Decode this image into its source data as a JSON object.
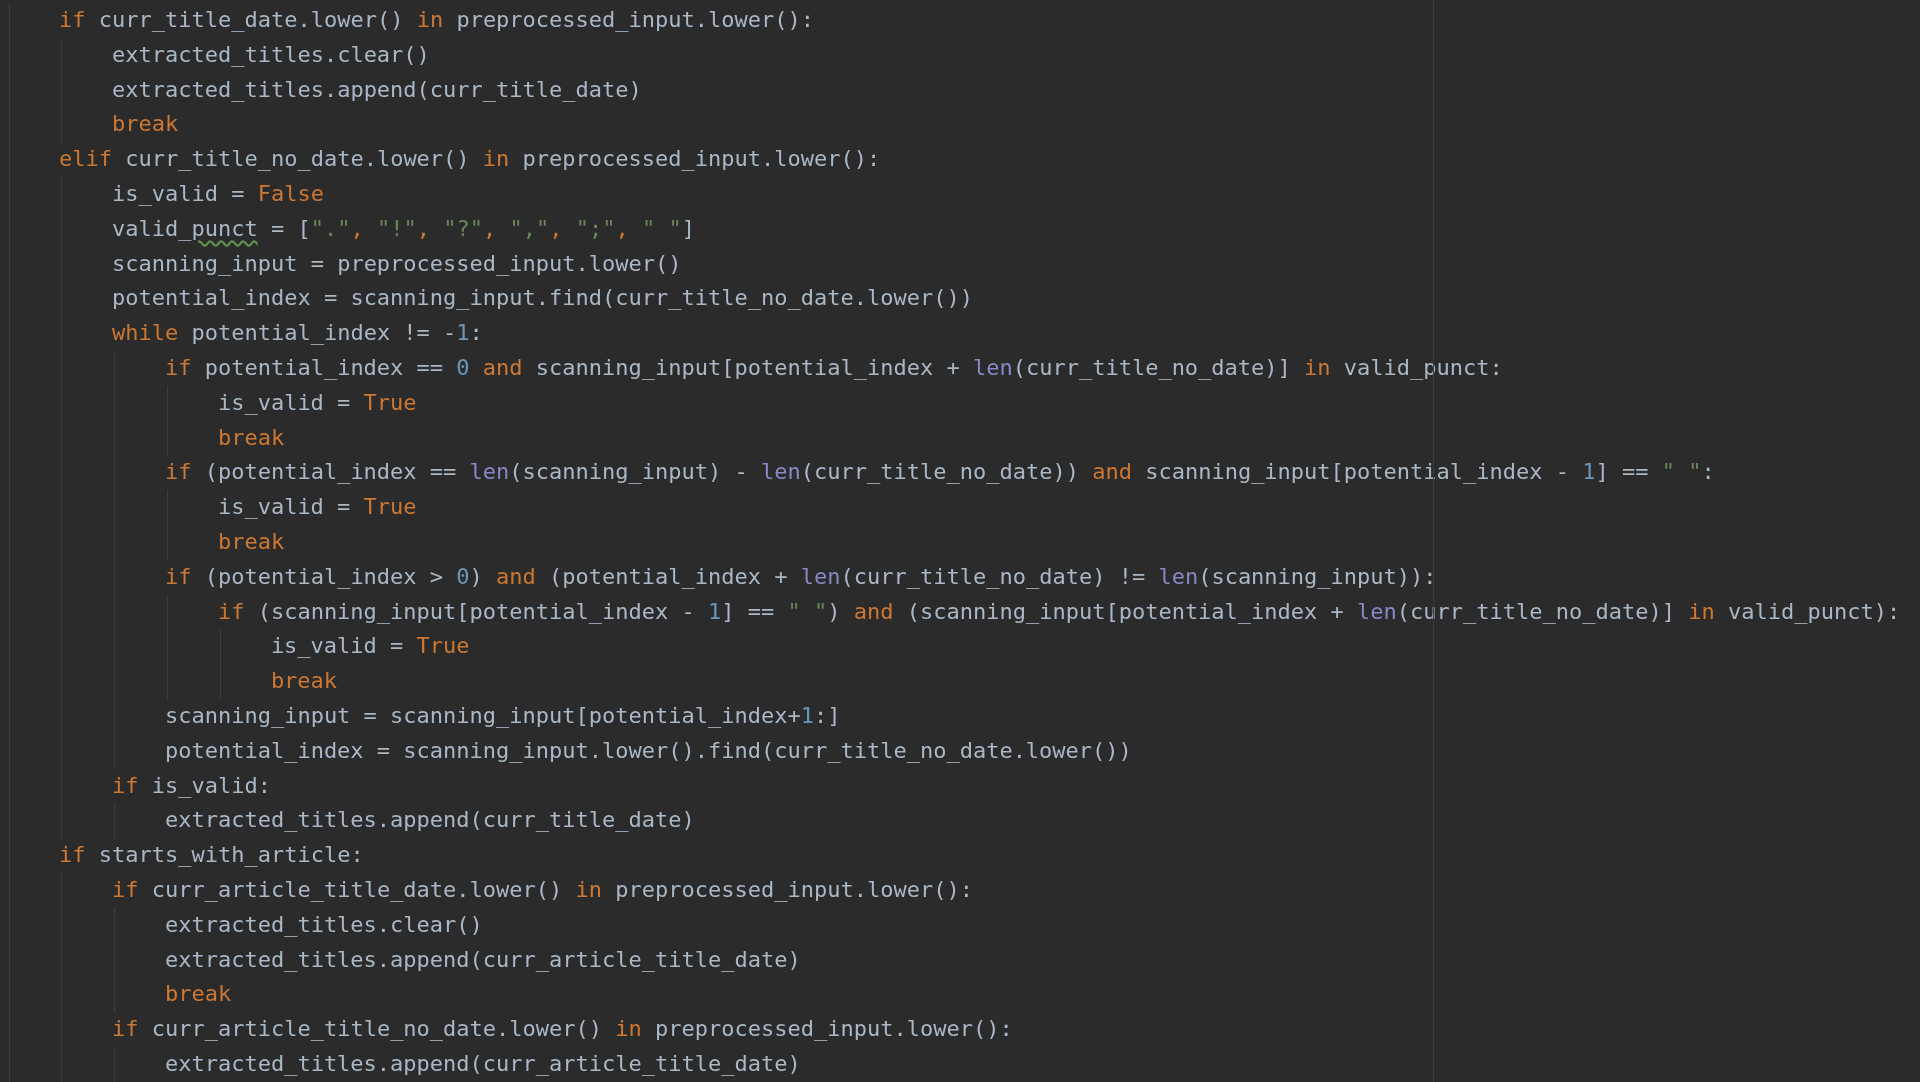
{
  "editor": {
    "lines": [
      {
        "tokens": [
          {
            "text": "if",
            "kind": "keyword"
          },
          {
            "text": " curr_title_date.lower() ",
            "kind": "plain"
          },
          {
            "text": "in",
            "kind": "keyword"
          },
          {
            "text": " preprocessed_input.lower():",
            "kind": "plain"
          }
        ],
        "children": [
          {
            "tokens": [
              {
                "text": "extracted_titles.clear()",
                "kind": "plain"
              }
            ]
          },
          {
            "tokens": [
              {
                "text": "extracted_titles.append(curr_title_date)",
                "kind": "plain"
              }
            ]
          },
          {
            "tokens": [
              {
                "text": "break",
                "kind": "keyword"
              }
            ]
          }
        ]
      },
      {
        "tokens": [
          {
            "text": "elif",
            "kind": "keyword"
          },
          {
            "text": " curr_title_no_date.lower() ",
            "kind": "plain"
          },
          {
            "text": "in",
            "kind": "keyword"
          },
          {
            "text": " preprocessed_input.lower():",
            "kind": "plain"
          }
        ],
        "children": [
          {
            "tokens": [
              {
                "text": "is_valid = ",
                "kind": "plain"
              },
              {
                "text": "False",
                "kind": "keyword"
              }
            ]
          },
          {
            "tokens": [
              {
                "text": "valid_",
                "kind": "plain"
              },
              {
                "text": "punct",
                "kind": "typo"
              },
              {
                "text": " = [",
                "kind": "plain"
              },
              {
                "text": "\".\"",
                "kind": "string"
              },
              {
                "text": ", ",
                "kind": "comma"
              },
              {
                "text": "\"!\"",
                "kind": "string"
              },
              {
                "text": ", ",
                "kind": "comma"
              },
              {
                "text": "\"?\"",
                "kind": "string"
              },
              {
                "text": ", ",
                "kind": "comma"
              },
              {
                "text": "\",\"",
                "kind": "string"
              },
              {
                "text": ", ",
                "kind": "comma"
              },
              {
                "text": "\";\"",
                "kind": "string"
              },
              {
                "text": ", ",
                "kind": "comma"
              },
              {
                "text": "\" \"",
                "kind": "string"
              },
              {
                "text": "]",
                "kind": "plain"
              }
            ]
          },
          {
            "tokens": [
              {
                "text": "scanning_input = preprocessed_input.lower()",
                "kind": "plain"
              }
            ]
          },
          {
            "tokens": [
              {
                "text": "potential_index = scanning_input.find(curr_title_no_date.lower())",
                "kind": "plain"
              }
            ]
          },
          {
            "tokens": [
              {
                "text": "while",
                "kind": "keyword"
              },
              {
                "text": " potential_index != -",
                "kind": "plain"
              },
              {
                "text": "1",
                "kind": "number"
              },
              {
                "text": ":",
                "kind": "plain"
              }
            ],
            "children": [
              {
                "tokens": [
                  {
                    "text": "if",
                    "kind": "keyword"
                  },
                  {
                    "text": " potential_index == ",
                    "kind": "plain"
                  },
                  {
                    "text": "0 ",
                    "kind": "number"
                  },
                  {
                    "text": "and",
                    "kind": "keyword"
                  },
                  {
                    "text": " scanning_input[potential_index + ",
                    "kind": "plain"
                  },
                  {
                    "text": "len",
                    "kind": "builtin"
                  },
                  {
                    "text": "(curr_title_no_date)] ",
                    "kind": "plain"
                  },
                  {
                    "text": "in",
                    "kind": "keyword"
                  },
                  {
                    "text": " valid_punct:",
                    "kind": "plain"
                  }
                ],
                "children": [
                  {
                    "tokens": [
                      {
                        "text": "is_valid = ",
                        "kind": "plain"
                      },
                      {
                        "text": "True",
                        "kind": "keyword"
                      }
                    ]
                  },
                  {
                    "tokens": [
                      {
                        "text": "break",
                        "kind": "keyword"
                      }
                    ]
                  }
                ]
              },
              {
                "tokens": [
                  {
                    "text": "if",
                    "kind": "keyword"
                  },
                  {
                    "text": " (potential_index == ",
                    "kind": "plain"
                  },
                  {
                    "text": "len",
                    "kind": "builtin"
                  },
                  {
                    "text": "(scanning_input) - ",
                    "kind": "plain"
                  },
                  {
                    "text": "len",
                    "kind": "builtin"
                  },
                  {
                    "text": "(curr_title_no_date)) ",
                    "kind": "plain"
                  },
                  {
                    "text": "and",
                    "kind": "keyword"
                  },
                  {
                    "text": " scanning_input[potential_index - ",
                    "kind": "plain"
                  },
                  {
                    "text": "1",
                    "kind": "number"
                  },
                  {
                    "text": "] == ",
                    "kind": "plain"
                  },
                  {
                    "text": "\" \"",
                    "kind": "string"
                  },
                  {
                    "text": ":",
                    "kind": "plain"
                  }
                ],
                "children": [
                  {
                    "tokens": [
                      {
                        "text": "is_valid = ",
                        "kind": "plain"
                      },
                      {
                        "text": "True",
                        "kind": "keyword"
                      }
                    ]
                  },
                  {
                    "tokens": [
                      {
                        "text": "break",
                        "kind": "keyword"
                      }
                    ]
                  }
                ]
              },
              {
                "tokens": [
                  {
                    "text": "if",
                    "kind": "keyword"
                  },
                  {
                    "text": " (potential_index > ",
                    "kind": "plain"
                  },
                  {
                    "text": "0",
                    "kind": "number"
                  },
                  {
                    "text": ") ",
                    "kind": "plain"
                  },
                  {
                    "text": "and",
                    "kind": "keyword"
                  },
                  {
                    "text": " (potential_index + ",
                    "kind": "plain"
                  },
                  {
                    "text": "len",
                    "kind": "builtin"
                  },
                  {
                    "text": "(curr_title_no_date) != ",
                    "kind": "plain"
                  },
                  {
                    "text": "len",
                    "kind": "builtin"
                  },
                  {
                    "text": "(scanning_input)):",
                    "kind": "plain"
                  }
                ],
                "children": [
                  {
                    "tokens": [
                      {
                        "text": "if",
                        "kind": "keyword"
                      },
                      {
                        "text": " (scanning_input[potential_index - ",
                        "kind": "plain"
                      },
                      {
                        "text": "1",
                        "kind": "number"
                      },
                      {
                        "text": "] == ",
                        "kind": "plain"
                      },
                      {
                        "text": "\" \"",
                        "kind": "string"
                      },
                      {
                        "text": ") ",
                        "kind": "plain"
                      },
                      {
                        "text": "and",
                        "kind": "keyword"
                      },
                      {
                        "text": " (scanning_input[potential_index + ",
                        "kind": "plain"
                      },
                      {
                        "text": "len",
                        "kind": "builtin"
                      },
                      {
                        "text": "(curr_title_no_date)] ",
                        "kind": "plain"
                      },
                      {
                        "text": "in",
                        "kind": "keyword"
                      },
                      {
                        "text": " valid_punct):",
                        "kind": "plain"
                      }
                    ],
                    "children": [
                      {
                        "tokens": [
                          {
                            "text": "is_valid = ",
                            "kind": "plain"
                          },
                          {
                            "text": "True",
                            "kind": "keyword"
                          }
                        ]
                      },
                      {
                        "tokens": [
                          {
                            "text": "break",
                            "kind": "keyword"
                          }
                        ]
                      }
                    ]
                  }
                ]
              },
              {
                "tokens": [
                  {
                    "text": "scanning_input = scanning_input[potential_index+",
                    "kind": "plain"
                  },
                  {
                    "text": "1",
                    "kind": "number"
                  },
                  {
                    "text": ":]",
                    "kind": "plain"
                  }
                ]
              },
              {
                "tokens": [
                  {
                    "text": "potential_index = scanning_input.lower().find(curr_title_no_date.lower())",
                    "kind": "plain"
                  }
                ]
              }
            ]
          },
          {
            "tokens": [
              {
                "text": "if",
                "kind": "keyword"
              },
              {
                "text": " is_valid:",
                "kind": "plain"
              }
            ],
            "children": [
              {
                "tokens": [
                  {
                    "text": "extracted_titles.append(curr_title_date)",
                    "kind": "plain"
                  }
                ]
              }
            ]
          }
        ]
      },
      {
        "tokens": [
          {
            "text": "if",
            "kind": "keyword"
          },
          {
            "text": " starts_with_article:",
            "kind": "plain"
          }
        ],
        "children": [
          {
            "tokens": [
              {
                "text": "if",
                "kind": "keyword"
              },
              {
                "text": " curr_article_title_date.lower() ",
                "kind": "plain"
              },
              {
                "text": "in",
                "kind": "keyword"
              },
              {
                "text": " preprocessed_input.lower():",
                "kind": "plain"
              }
            ],
            "children": [
              {
                "tokens": [
                  {
                    "text": "extracted_titles.clear()",
                    "kind": "plain"
                  }
                ]
              },
              {
                "tokens": [
                  {
                    "text": "extracted_titles.append(curr_article_title_date)",
                    "kind": "plain"
                  }
                ]
              },
              {
                "tokens": [
                  {
                    "text": "break",
                    "kind": "keyword"
                  }
                ]
              }
            ]
          },
          {
            "tokens": [
              {
                "text": "if",
                "kind": "keyword"
              },
              {
                "text": " curr_article_title_no_date.lower() ",
                "kind": "plain"
              },
              {
                "text": "in",
                "kind": "keyword"
              },
              {
                "text": " preprocessed_input.lower():",
                "kind": "plain"
              }
            ],
            "children": [
              {
                "tokens": [
                  {
                    "text": "extracted_titles.append(curr_article_title_date)",
                    "kind": "plain"
                  }
                ]
              }
            ]
          }
        ]
      }
    ]
  }
}
